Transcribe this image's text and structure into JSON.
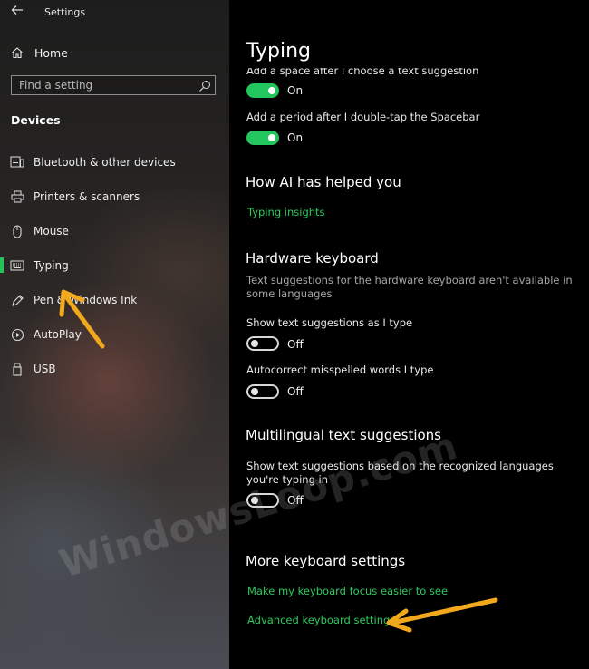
{
  "window": {
    "title": "Settings"
  },
  "sidebar": {
    "home_label": "Home",
    "search_placeholder": "Find a setting",
    "section_title": "Devices",
    "items": [
      {
        "label": "Bluetooth & other devices",
        "icon": "bluetooth-devices-icon"
      },
      {
        "label": "Printers & scanners",
        "icon": "printer-icon"
      },
      {
        "label": "Mouse",
        "icon": "mouse-icon"
      },
      {
        "label": "Typing",
        "icon": "keyboard-icon",
        "active": true
      },
      {
        "label": "Pen & Windows Ink",
        "icon": "pen-icon"
      },
      {
        "label": "AutoPlay",
        "icon": "autoplay-icon"
      },
      {
        "label": "USB",
        "icon": "usb-icon"
      }
    ]
  },
  "main": {
    "title": "Typing",
    "settings_top": [
      {
        "label": "Add a space after I choose a text suggestion",
        "state": "On"
      },
      {
        "label": "Add a period after I double-tap the Spacebar",
        "state": "On"
      }
    ],
    "ai_section": {
      "heading": "How AI has helped you",
      "link": "Typing insights"
    },
    "hardware": {
      "heading": "Hardware keyboard",
      "description": "Text suggestions for the hardware keyboard aren't available in some languages",
      "settings": [
        {
          "label": "Show text suggestions as I type",
          "state": "Off"
        },
        {
          "label": "Autocorrect misspelled words I type",
          "state": "Off"
        }
      ]
    },
    "multilingual": {
      "heading": "Multilingual text suggestions",
      "label": "Show text suggestions based on the recognized languages you're typing in",
      "state": "Off"
    },
    "more": {
      "heading": "More keyboard settings",
      "links": [
        "Make my keyboard focus easier to see",
        "Advanced keyboard settings"
      ]
    }
  },
  "watermark": "WindowsLoop.com",
  "colors": {
    "accent": "#22c55e",
    "annotation_arrow": "#f2a81d",
    "background": "#000000"
  }
}
